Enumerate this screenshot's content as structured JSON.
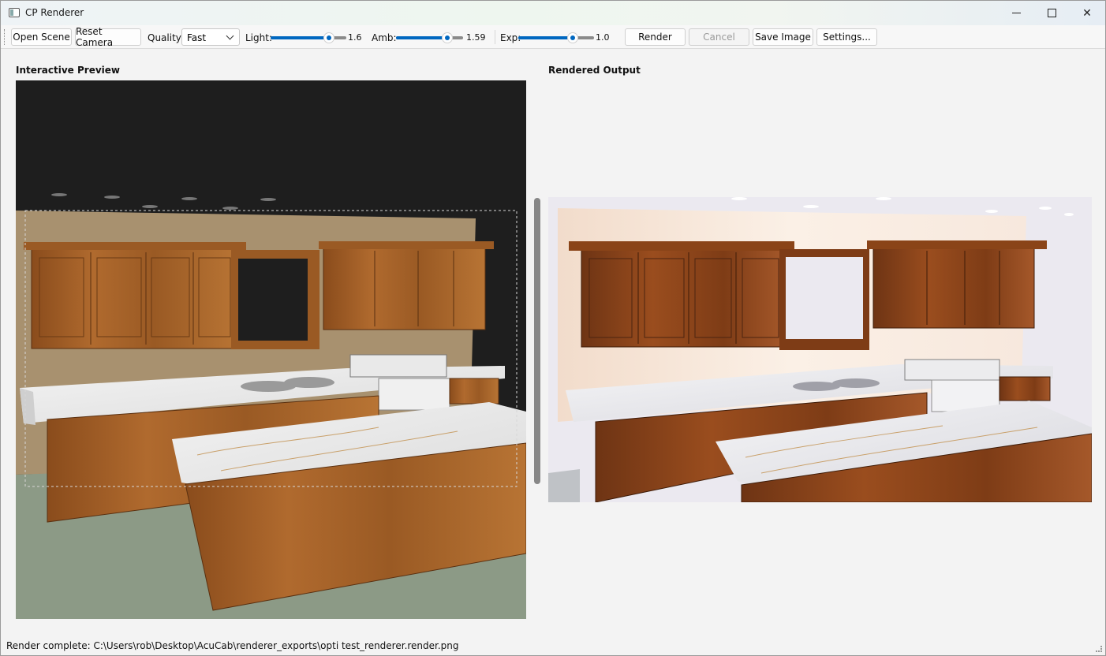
{
  "window": {
    "title": "CP Renderer",
    "minimize_icon": "minimize-icon",
    "maximize_icon": "maximize-icon",
    "close_icon": "close-icon"
  },
  "toolbar": {
    "open_scene": "Open Scene",
    "reset_camera": "Reset Camera",
    "quality_label": "Quality:",
    "quality_value": "Fast",
    "light_label": "Light:",
    "light_value": "1.6",
    "amb_label": "Amb:",
    "amb_value": "1.59",
    "exp_label": "Exp:",
    "exp_value": "1.0",
    "render": "Render",
    "cancel": "Cancel",
    "save_image": "Save Image",
    "settings": "Settings...",
    "accent_color": "#0067c0"
  },
  "sliders": {
    "light_fill": 0.73,
    "amb_fill": 0.72,
    "exp_fill": 0.73
  },
  "panels": {
    "preview_title": "Interactive Preview",
    "output_title": "Rendered Output"
  },
  "status": {
    "text": "Render complete: C:\\Users\\rob\\Desktop\\AcuCab\\renderer_exports\\opti test_renderer.render.png"
  }
}
